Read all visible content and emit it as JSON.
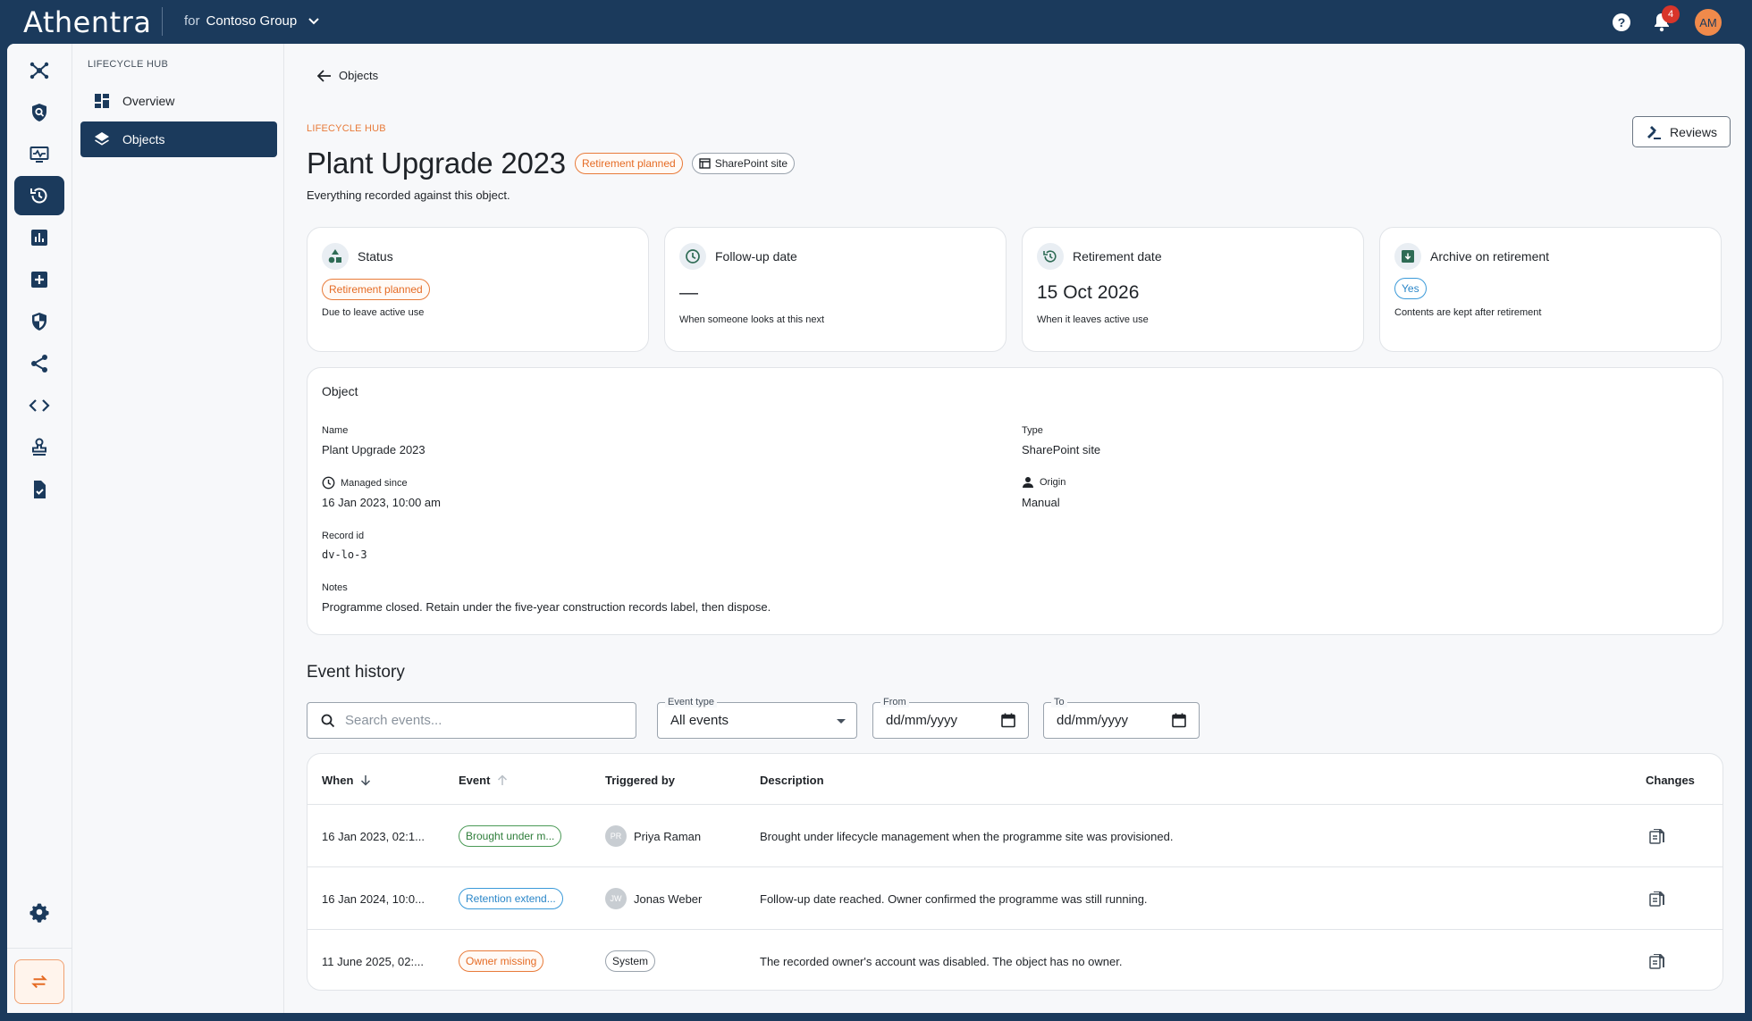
{
  "app": {
    "name": "Athentra",
    "tenant_prefix": "for",
    "tenant": "Contoso Group",
    "notifications": "4",
    "user_initials": "AM"
  },
  "sidebar": {
    "section_title": "LIFECYCLE HUB",
    "items": [
      {
        "label": "Overview",
        "icon": "dashboard-icon"
      },
      {
        "label": "Objects",
        "icon": "layers-icon"
      }
    ]
  },
  "rail": {
    "icons": [
      "hub-icon",
      "shield-search-icon",
      "monitor-icon",
      "history-icon",
      "bar-chart-icon",
      "add-box-icon",
      "security-icon",
      "share-icon",
      "code-icon",
      "stamp-icon",
      "task-icon",
      "settings-icon",
      "swap-icon"
    ],
    "active": "history-icon"
  },
  "page": {
    "back_label": "Objects",
    "eyebrow": "LIFECYCLE HUB",
    "title": "Plant Upgrade 2023",
    "status_chip": "Retirement planned",
    "type_chip": "SharePoint site",
    "subtitle": "Everything recorded against this object.",
    "reviews_button": "Reviews"
  },
  "stats": {
    "status": {
      "label": "Status",
      "value": "Retirement planned",
      "note": "Due to leave active use"
    },
    "followup": {
      "label": "Follow-up date",
      "value": "—",
      "note": "When someone looks at this next"
    },
    "retirement": {
      "label": "Retirement date",
      "value": "15 Oct 2026",
      "note": "When it leaves active use"
    },
    "archive": {
      "label": "Archive on retirement",
      "value": "Yes",
      "note": "Contents are kept after retirement"
    }
  },
  "object": {
    "title": "Object",
    "name_label": "Name",
    "name": "Plant Upgrade 2023",
    "managed_label": "Managed since",
    "managed": "16 Jan 2023, 10:00 am",
    "record_label": "Record id",
    "record": "dv-lo-3",
    "notes_label": "Notes",
    "notes": "Programme closed. Retain under the five-year construction records label, then dispose.",
    "type_label": "Type",
    "type": "SharePoint site",
    "origin_label": "Origin",
    "origin": "Manual"
  },
  "events": {
    "title": "Event history",
    "search_placeholder": "Search events...",
    "event_type_label": "Event type",
    "event_type_value": "All events",
    "from_label": "From",
    "from_value": "dd/mm/yyyy",
    "to_label": "To",
    "to_value": "dd/mm/yyyy",
    "columns": {
      "when": "When",
      "event": "Event",
      "triggered_by": "Triggered by",
      "description": "Description",
      "changes": "Changes"
    },
    "rows": [
      {
        "when": "16 Jan 2023, 02:1...",
        "event": "Brought under m...",
        "event_color": "green",
        "initials": "PR",
        "by": "Priya Raman",
        "description": "Brought under lifecycle management when the programme site was provisioned."
      },
      {
        "when": "16 Jan 2024, 10:0...",
        "event": "Retention extend...",
        "event_color": "blue",
        "initials": "JW",
        "by": "Jonas Weber",
        "description": "Follow-up date reached. Owner confirmed the programme was still running."
      },
      {
        "when": "11 June 2025, 02:...",
        "event": "Owner missing",
        "event_color": "orange",
        "initials": "",
        "by": "System",
        "description": "The recorded owner's account was disabled. The object has no owner."
      }
    ]
  },
  "colors": {
    "brand": "#1b3a5c",
    "accent": "#e87b3a",
    "green": "#4b9a57",
    "blue": "#3b9ad9"
  }
}
